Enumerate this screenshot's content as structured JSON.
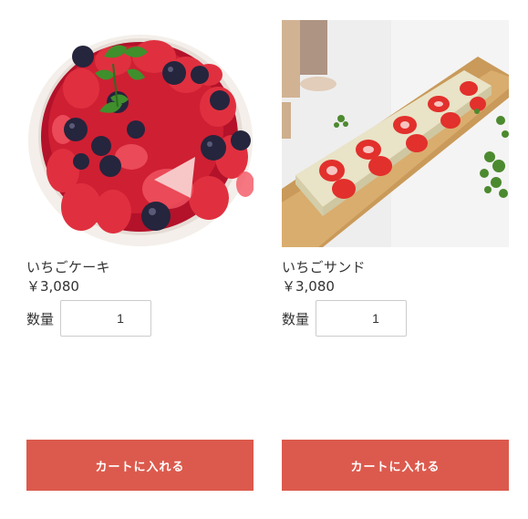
{
  "products": [
    {
      "name": "いちごケーキ",
      "price": "￥3,080",
      "quantity_label": "数量",
      "quantity_value": "1",
      "cart_button_label": "カートに入れる",
      "image_icon": "strawberry-cake-photo"
    },
    {
      "name": "いちごサンド",
      "price": "￥3,080",
      "quantity_label": "数量",
      "quantity_value": "1",
      "cart_button_label": "カートに入れる",
      "image_icon": "strawberry-sandwich-photo"
    }
  ],
  "colors": {
    "cart_button": "#dc5a4d",
    "text": "#333333",
    "input_border": "#cccccc"
  }
}
